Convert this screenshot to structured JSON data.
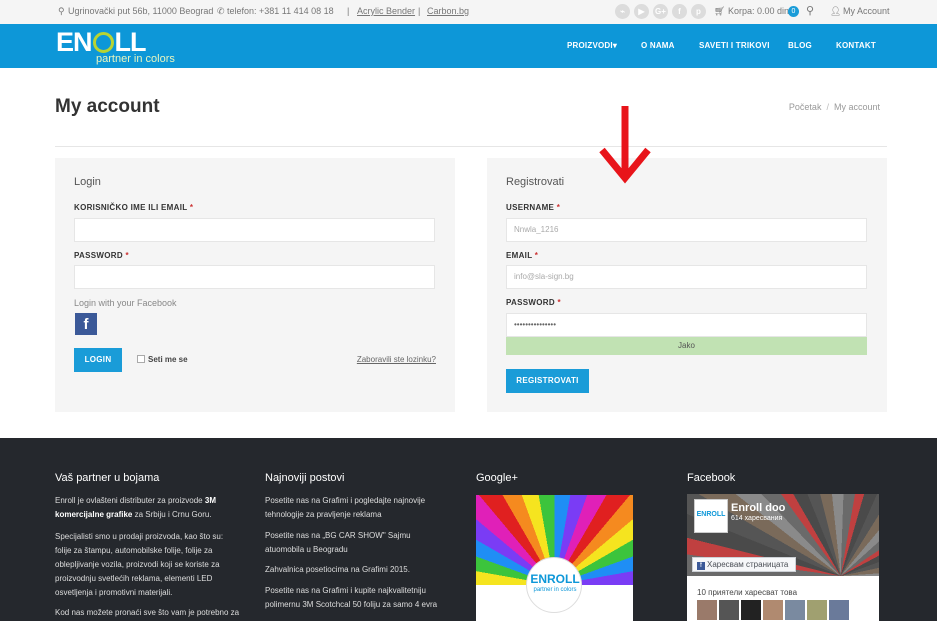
{
  "topbar": {
    "address": "Ugrinovački put 56b, 11000 Beograd",
    "phone": "telefon: +381 11 414 08 18",
    "link1": "Acrylic Bender",
    "link2": "Carbon.bg",
    "social_icons": [
      "rss-icon",
      "youtube-icon",
      "google-plus-icon",
      "facebook-icon",
      "pinterest-icon"
    ],
    "social_glyphs": [
      "⌁",
      "▶",
      "G+",
      "f",
      "p"
    ],
    "cart_label": "Korpa: 0.00 din",
    "cart_count": "0",
    "account_label": "My Account"
  },
  "header": {
    "logo_text": "ENROLL",
    "logo_tagline": "partner in colors",
    "nav": [
      "PROIZVODI",
      "O NAMA",
      "SAVETI I TRIKOVI",
      "BLOG",
      "KONTAKT"
    ]
  },
  "page": {
    "title": "My account",
    "breadcrumb": [
      "Početak",
      "My account"
    ]
  },
  "login": {
    "title": "Login",
    "username_label": "KORISNIČKO IME ILI EMAIL",
    "password_label": "PASSWORD",
    "required_mark": "*",
    "facebook_text": "Login with your Facebook",
    "submit_label": "LOGIN",
    "remember_label": "Seti me se",
    "forgot_label": "Zaboravili ste lozinku?"
  },
  "register": {
    "title": "Registrovati",
    "username_label": "USERNAME",
    "username_value": "Nnwla_1216",
    "email_label": "EMAIL",
    "email_value": "info@sla-sign.bg",
    "password_label": "PASSWORD",
    "password_value": "•••••••••••••••",
    "strength_label": "Jako",
    "submit_label": "REGISTROVATI",
    "required_mark": "*"
  },
  "footer": {
    "col1_title": "Vaš partner u bojama",
    "col1_p1_a": "Enroll je ovlašteni distributer za proizvode",
    "col1_p1_b": "3M komercijalne grafike",
    "col1_p1_c": "za Srbiju i Crnu Goru.",
    "col1_p2": "Specijalisti smo u prodaji proizvoda, kao što su: folije za štampu, automobilske folije, folije za oblepljivanje vozila, proizvodi koji se koriste za proizvodnju svetlećih reklama, elementi LED osvetljenja i promotivni materijali.",
    "col1_p3": "Kod nas možete pronaći sve što vam je potrebno za",
    "col2_title": "Najnoviji postovi",
    "posts": [
      "Posetite nas na Grafimi i pogledajte najnovije tehnologije za pravljenje reklama",
      "Posetite nas na „BG CAR SHOW\" Sajmu atuomobila u Beogradu",
      "Zahvalnica posetiocima na Grafimi 2015.",
      "Posetite nas na Grafimi i kupite najkvalitetniju polimernu 3M Scotchcal 50 foliju za samo 4 evra"
    ],
    "col3_title": "Google+",
    "gplus_logo": "ENROLL",
    "gplus_tag": "partner in colors",
    "col4_title": "Facebook",
    "fb_page_name": "Enroll doo",
    "fb_likes": "614 харесвания",
    "fb_avatar_text": "ENROLL",
    "fb_like_button": "Харесвам страницата",
    "fb_friends": "10 приятели харесват това"
  },
  "colors": {
    "brand_blue": "#0d97d8",
    "button_blue": "#1a9cd8",
    "logo_green": "#b8d432",
    "arrow_red": "#e8141a",
    "footer_bg": "#25282d",
    "strength_green": "#c1e2b3"
  }
}
